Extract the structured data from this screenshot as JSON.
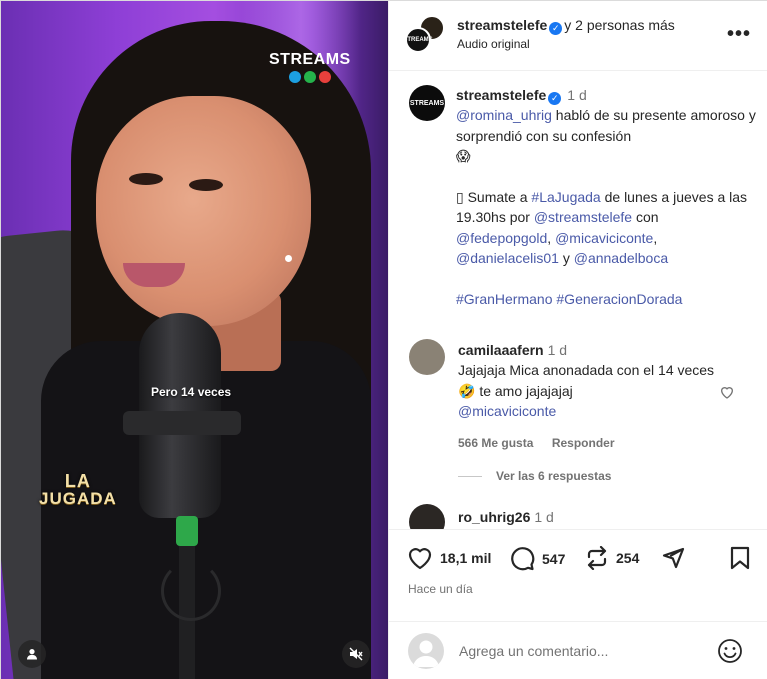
{
  "video": {
    "logo_text": "STREAMS",
    "logo_dots": [
      "#1c9fe0",
      "#25b34b",
      "#e8403c"
    ],
    "subtitle": "Pero 14 veces",
    "show_name_line1": "LA",
    "show_name_line2": "JUGADA"
  },
  "header": {
    "username": "streamstelefe",
    "collab_text": "y 2 personas más",
    "audio": "Audio original",
    "avatar_text": "STREAMS"
  },
  "caption": {
    "username": "streamstelefe",
    "time": "1 d",
    "avatar_text": "STREAMS",
    "mention1": "@romina_uhrig",
    "text1": " habló de su presente amoroso y sorprendió con su confesión",
    "emoji1": "😱",
    "text2a": "▯ Sumate a ",
    "hashtag1": "#LaJugada",
    "text2b": " de lunes a jueves a las 19.30hs por ",
    "mention2": "@streamstelefe",
    "text2c": " con ",
    "mention3": "@fedepopgold",
    "sep1": ", ",
    "mention4": "@micaviciconte",
    "sep2": ", ",
    "mention5": "@danielacelis01",
    "sep3": " y ",
    "mention6": "@annadelboca",
    "hashtag2": "#GranHermano",
    "hashtag3": "#GeneracionDorada"
  },
  "comment1": {
    "username": "camilaaafern",
    "time": "1 d",
    "text_a": "Jajajaja Mica anonadada con el 14 veces ",
    "emoji": "🤣",
    "text_b": " te amo jajajajaj",
    "mention": "@micaviciconte",
    "likes": "566 Me gusta",
    "reply": "Responder",
    "view_replies": "Ver las 6 respuestas"
  },
  "comment2": {
    "username": "ro_uhrig26",
    "time": "1 d"
  },
  "actions": {
    "likes": "18,1 mil",
    "comments": "547",
    "reposts": "254",
    "timestamp": "Hace un día"
  },
  "composer": {
    "placeholder": "Agrega un comentario..."
  }
}
